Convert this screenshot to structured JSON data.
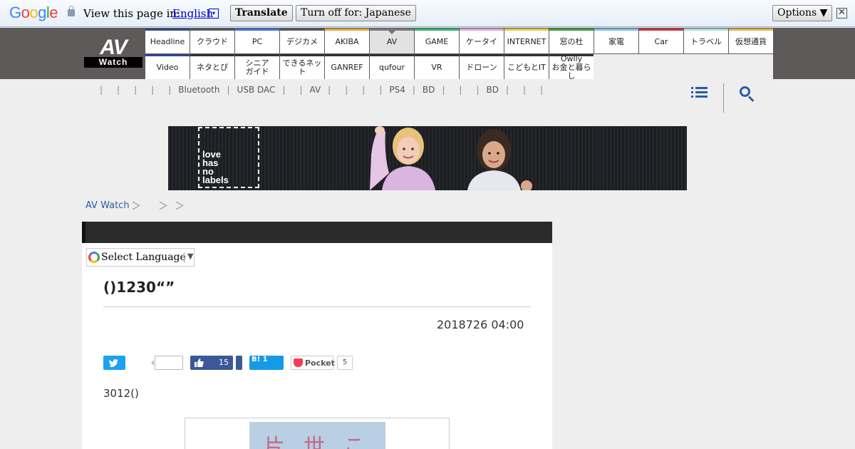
{
  "translate_bar": {
    "logo": {
      "g1": "G",
      "o1": "o",
      "o2": "o",
      "g2": "g",
      "l": "l",
      "e": "e"
    },
    "view_label": "View this page in:",
    "language": "English",
    "language_arrow": "▾",
    "translate_button": "Translate",
    "turn_off_button": "Turn off for: Japanese",
    "options_button": "Options ▼",
    "close": "✕"
  },
  "logo": {
    "av": "AV",
    "watch": "Watch"
  },
  "nav": {
    "row1": [
      {
        "label": "Headline",
        "color": "#2d4a8a",
        "active": false
      },
      {
        "label": "クラウド",
        "color": "#555555",
        "active": false
      },
      {
        "label": "PC",
        "color": "#3e6fd8",
        "active": false
      },
      {
        "label": "デジカメ",
        "color": "#555555",
        "active": false
      },
      {
        "label": "AKIBA",
        "color": "#e2a23b",
        "active": false
      },
      {
        "label": "AV",
        "color": "#777777",
        "active": true
      },
      {
        "label": "GAME",
        "color": "#2fb36b",
        "active": false
      },
      {
        "label": "ケータイ",
        "color": "#d9a6d6",
        "active": false
      },
      {
        "label": "INTERNET",
        "color": "#e5c640",
        "active": false
      },
      {
        "label": "窓の杜",
        "color": "#3d9a45",
        "active": false
      },
      {
        "label": "家電",
        "color": "#7fbce4",
        "active": false
      },
      {
        "label": "Car",
        "color": "#c0343f",
        "active": false
      },
      {
        "label": "トラベル",
        "color": "#a9dcd0",
        "active": false
      },
      {
        "label": "仮想通貨",
        "color": "#e0b34a",
        "active": false
      }
    ],
    "row2": [
      {
        "label": "Video",
        "color": "#2d4a8a"
      },
      {
        "label": "ネタとぴ",
        "color": "#333333"
      },
      {
        "label": "シニア\nガイド",
        "color": "#333333"
      },
      {
        "label": "できるネット",
        "color": "#333333"
      },
      {
        "label": "GANREF",
        "color": "#333333"
      },
      {
        "label": "qufour",
        "color": "#333333"
      },
      {
        "label": "VR",
        "color": "#333333"
      },
      {
        "label": "ドローン",
        "color": "#333333"
      },
      {
        "label": "こどもとIT",
        "color": "#333333"
      },
      {
        "label": "Owlly\nお金と暮らし",
        "color": "#333333"
      }
    ]
  },
  "subnav": [
    "",
    "",
    "",
    "",
    "Bluetooth",
    "USB DAC",
    "",
    "AV",
    "",
    "",
    "",
    "PS4",
    "BD",
    "",
    "",
    "BD",
    "",
    "",
    ""
  ],
  "banner": {
    "text": "love\nhas\nno\nlabels"
  },
  "breadcrumb": {
    "home": "AV Watch"
  },
  "select_language": {
    "label": "Select Language",
    "arrow": "▼"
  },
  "article": {
    "title": "()1230“”",
    "date": "2018726 04:00",
    "share": {
      "facebook_count": "15",
      "hatena_label": "B! 1",
      "pocket_label": "Pocket",
      "pocket_count": "5"
    },
    "body": "3012()",
    "figure_chars": "片世こ"
  }
}
